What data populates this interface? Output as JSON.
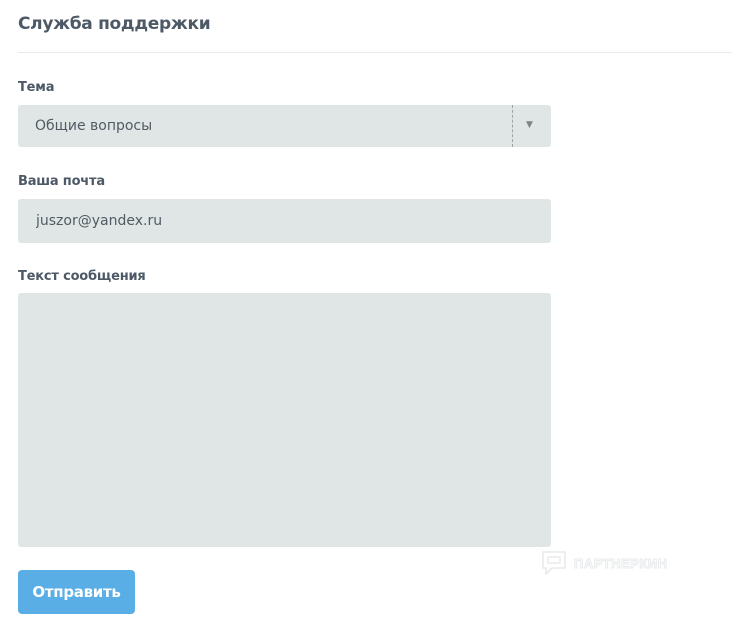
{
  "page": {
    "title": "Служба поддержки"
  },
  "form": {
    "topic": {
      "label": "Тема",
      "selected": "Общие вопросы",
      "arrow_icon": "dropdown-arrow-icon"
    },
    "email": {
      "label": "Ваша почта",
      "value": "juszor@yandex.ru"
    },
    "message": {
      "label": "Текст сообщения",
      "value": ""
    },
    "submit_label": "Отправить"
  },
  "watermark": {
    "text": "ПАРТНЕРКИН",
    "icon": "chat-bubble-icon"
  },
  "colors": {
    "heading": "#4d5966",
    "field_bg": "#dfe6e5",
    "button_bg": "#5aaee6",
    "button_text": "#ffffff"
  }
}
